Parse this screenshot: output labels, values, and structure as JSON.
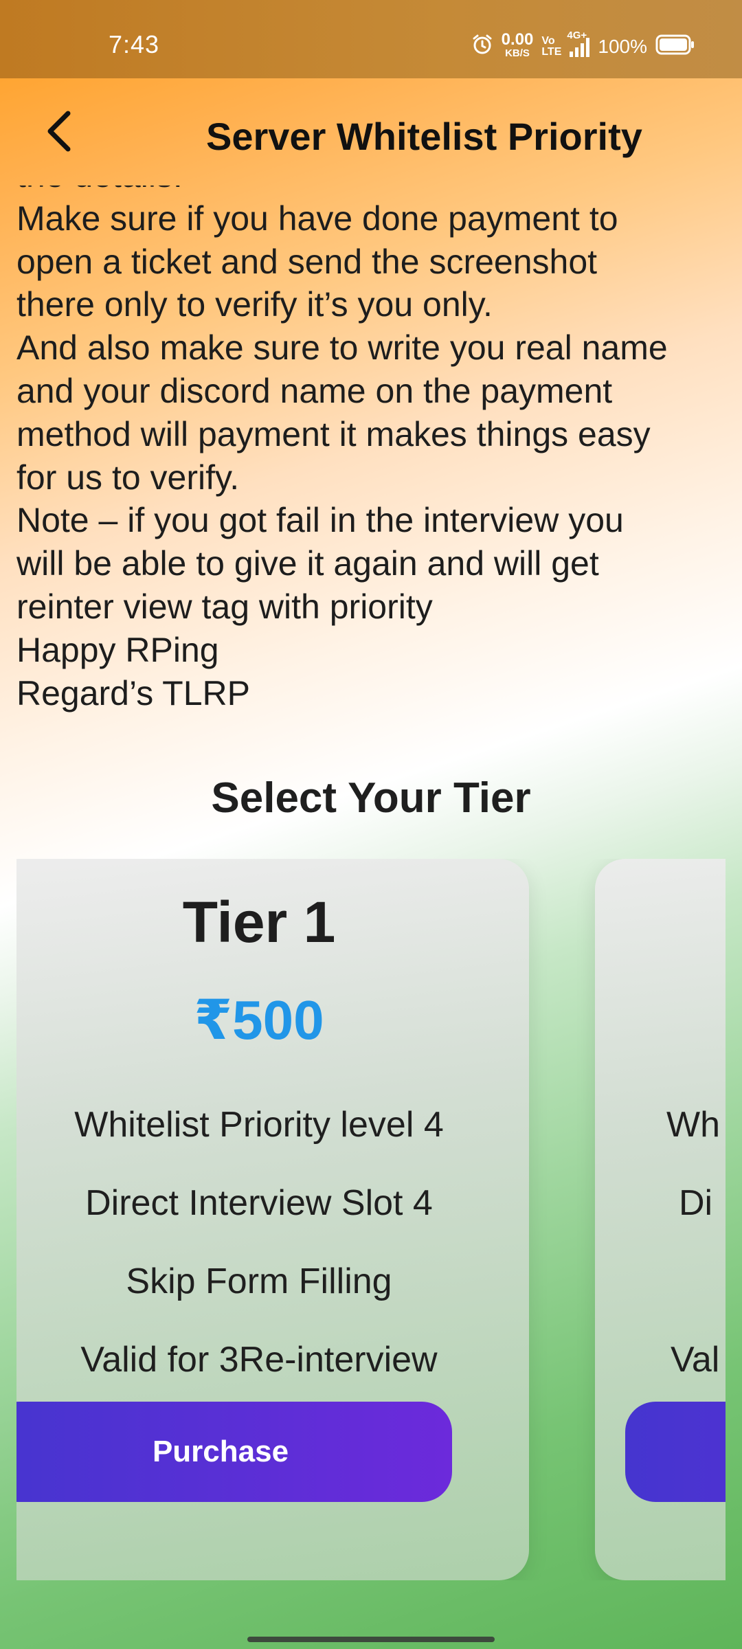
{
  "status_bar": {
    "time": "7:43",
    "net_speed_value": "0.00",
    "net_speed_unit": "KB/S",
    "volte_top": "Vo",
    "volte_bottom": "LTE",
    "network": "4G+",
    "battery": "100%"
  },
  "header": {
    "title": "Server Whitelist Priority"
  },
  "description": {
    "lines": [
      "the details.",
      "Make sure if you have done payment to",
      "open a ticket and send the screenshot",
      "there only to verify it’s you only.",
      "And also make sure to write you real name",
      "and your discord name on the payment",
      "method will payment it makes things easy",
      "for us to verify.",
      "Note – if you got fail in the interview you",
      "will be able to give it again and will get",
      "reinter view tag with priority",
      "Happy RPing",
      "Regard’s TLRP"
    ]
  },
  "tiers_section": {
    "title": "Select Your Tier",
    "tiers": [
      {
        "name": "Tier 1",
        "price": "₹500",
        "features": [
          "Whitelist Priority level 4",
          "Direct Interview Slot 4",
          "Skip Form Filling",
          "Valid for 3Re-interview"
        ],
        "button_label": "Purchase"
      },
      {
        "features_visible": [
          "Wh",
          "Di",
          "Val"
        ]
      }
    ]
  },
  "colors": {
    "price": "#2196e8",
    "button_start": "#4535cf",
    "button_end": "#6c2adb"
  }
}
